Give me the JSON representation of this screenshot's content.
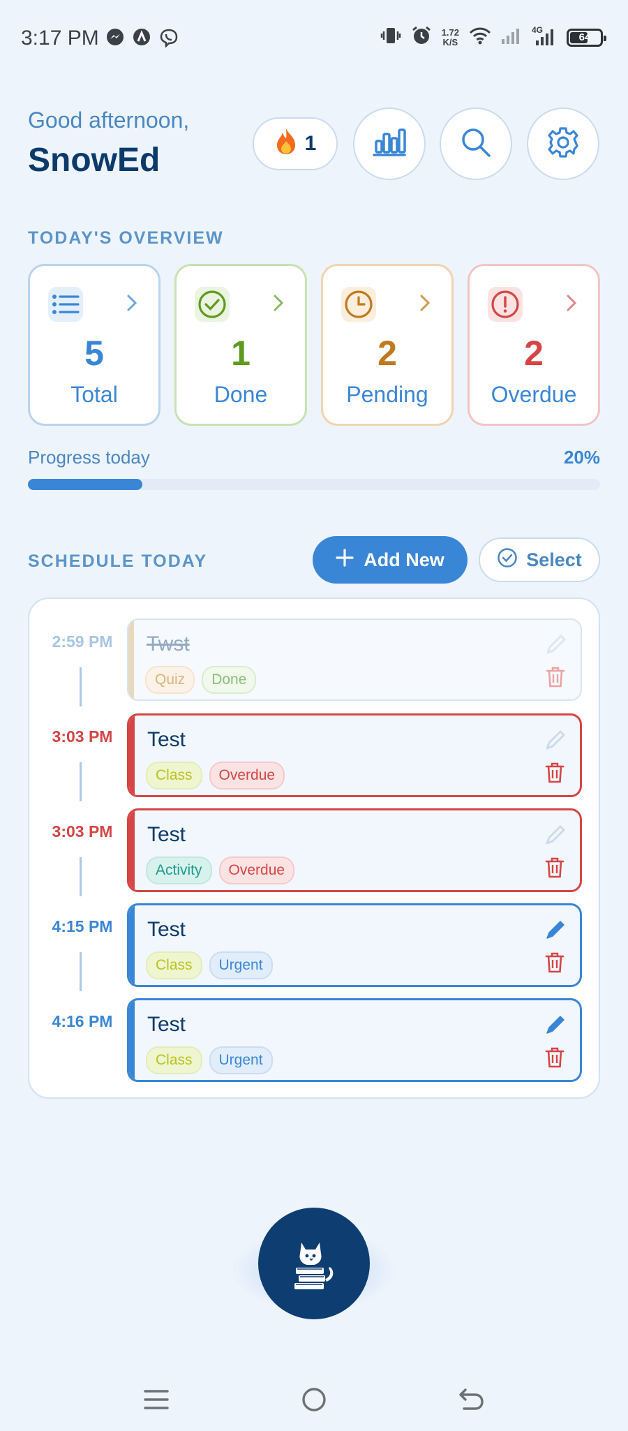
{
  "status_bar": {
    "time": "3:17 PM",
    "net_speed_value": "1.72",
    "net_speed_unit": "K/S",
    "network_type": "4G",
    "battery": "64",
    "left_icons": [
      "messenger-icon",
      "app-a-icon",
      "viber-icon"
    ],
    "right_icons": [
      "vibrate-icon",
      "alarm-icon",
      "wifi-icon",
      "signal-icon",
      "signal-4g-icon",
      "battery-icon"
    ]
  },
  "header": {
    "greeting": "Good afternoon,",
    "username": "SnowEd",
    "streak_count": "1",
    "streak_icon": "fire-icon",
    "buttons": [
      "stats-icon",
      "search-icon",
      "settings-icon"
    ]
  },
  "overview": {
    "title": "TODAY'S OVERVIEW",
    "cards": [
      {
        "count": "5",
        "label": "Total",
        "icon": "list-icon",
        "color": "#3a86d6"
      },
      {
        "count": "1",
        "label": "Done",
        "icon": "check-circle-icon",
        "color": "#5f9a1e"
      },
      {
        "count": "2",
        "label": "Pending",
        "icon": "clock-icon",
        "color": "#c07a1e"
      },
      {
        "count": "2",
        "label": "Overdue",
        "icon": "alert-circle-icon",
        "color": "#d64545"
      }
    ]
  },
  "progress": {
    "label": "Progress today",
    "percent_text": "20%",
    "fraction": 0.2
  },
  "schedule": {
    "title": "SCHEDULE TODAY",
    "add_label": "Add New",
    "select_label": "Select",
    "items": [
      {
        "time": "2:59 PM",
        "title": "Twst",
        "tags": [
          "Quiz",
          "Done"
        ],
        "state": "done"
      },
      {
        "time": "3:03 PM",
        "title": "Test",
        "tags": [
          "Class",
          "Overdue"
        ],
        "state": "overdue"
      },
      {
        "time": "3:03 PM",
        "title": "Test",
        "tags": [
          "Activity",
          "Overdue"
        ],
        "state": "overdue"
      },
      {
        "time": "4:15 PM",
        "title": "Test",
        "tags": [
          "Class",
          "Urgent"
        ],
        "state": "urgent"
      },
      {
        "time": "4:16 PM",
        "title": "Test",
        "tags": [
          "Class",
          "Urgent"
        ],
        "state": "urgent"
      }
    ]
  },
  "fab": {
    "icon": "cat-with-books-icon"
  },
  "nav": {
    "icons": [
      "menu-icon",
      "home-icon",
      "back-icon"
    ]
  },
  "colors": {
    "background": "#eef4fc",
    "primary": "#3a86d6",
    "navy": "#0c3a6b",
    "overdue": "#d64545",
    "done": "#5f9a1e",
    "pending": "#c07a1e"
  }
}
